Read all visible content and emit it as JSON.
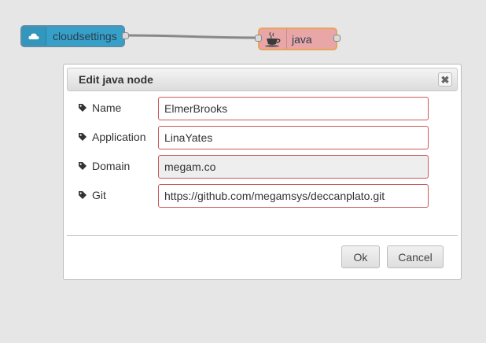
{
  "canvas": {
    "nodes": [
      {
        "label": "cloudsettings",
        "icon": "cloud-icon",
        "color": "#36a0c8"
      },
      {
        "label": "java",
        "icon": "java-cup-icon",
        "color": "#e9a6a6"
      }
    ]
  },
  "dialog": {
    "title": "Edit java node",
    "close_icon": "close-icon",
    "fields": [
      {
        "label": "Name",
        "value": "ElmerBrooks",
        "icon": "tag-icon"
      },
      {
        "label": "Application",
        "value": "LinaYates",
        "icon": "tag-icon"
      },
      {
        "label": "Domain",
        "value": "megam.co",
        "icon": "tag-icon"
      },
      {
        "label": "Git",
        "value": "https://github.com/megamsys/deccanplato.git",
        "icon": "tag-icon"
      }
    ],
    "ok_label": "Ok",
    "cancel_label": "Cancel"
  }
}
